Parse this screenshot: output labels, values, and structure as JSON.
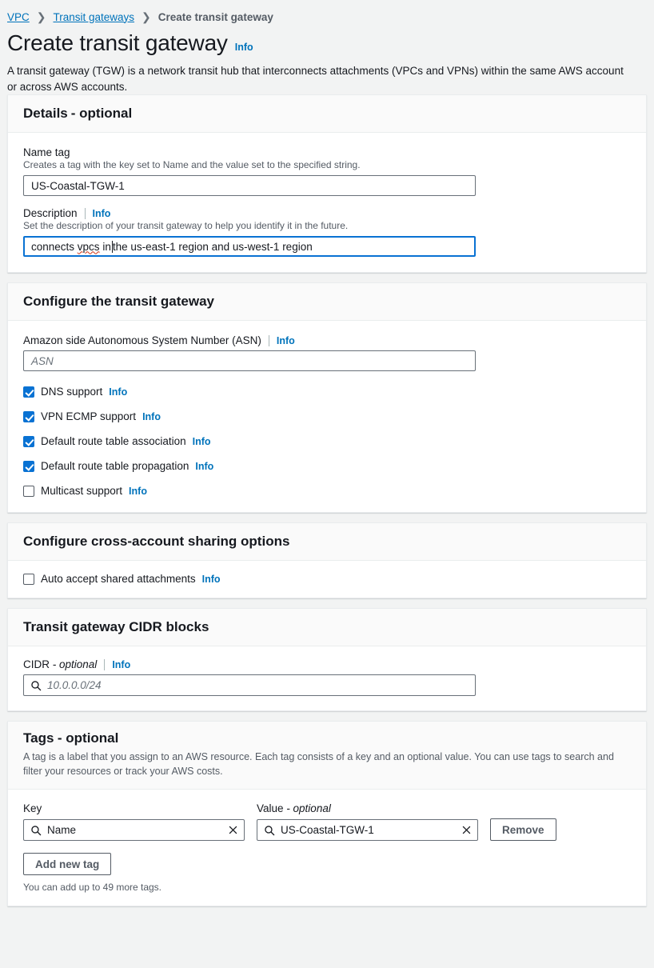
{
  "breadcrumb": {
    "items": [
      {
        "label": "VPC",
        "link": true
      },
      {
        "label": "Transit gateways",
        "link": true
      },
      {
        "label": "Create transit gateway",
        "link": false
      }
    ],
    "separator": "❯"
  },
  "header": {
    "title": "Create transit gateway",
    "info_label": "Info",
    "description": "A transit gateway (TGW) is a network transit hub that interconnects attachments (VPCs and VPNs) within the same AWS account or across AWS accounts."
  },
  "colors": {
    "link": "#0073bb",
    "info": "#0073bb",
    "accent": "#0972d3",
    "page_bg": "#f2f3f3",
    "panel_header_bg": "#fafafa",
    "panel_bg": "#ffffff",
    "border": "#687078",
    "muted_text": "#545b64",
    "spellcheck": "#d13212"
  },
  "details_panel": {
    "title": "Details",
    "title_optional": "- optional",
    "name_tag": {
      "label": "Name tag",
      "hint": "Creates a tag with the key set to Name and the value set to the specified string.",
      "value": "US-Coastal-TGW-1",
      "placeholder": ""
    },
    "description_field": {
      "label": "Description",
      "info_label": "Info",
      "hint": "Set the description of your transit gateway to help you identify it in the future.",
      "value_before_caret": "connects vpcs in",
      "value_after_caret": " the us-east-1 region and us-west-1 region",
      "misspelled_word": "vpcs",
      "focused": true
    }
  },
  "configure_panel": {
    "title": "Configure the transit gateway",
    "asn": {
      "label": "Amazon side Autonomous System Number (ASN)",
      "info_label": "Info",
      "value": "",
      "placeholder": "ASN"
    },
    "checkboxes": [
      {
        "label": "DNS support",
        "info_label": "Info",
        "checked": true
      },
      {
        "label": "VPN ECMP support",
        "info_label": "Info",
        "checked": true
      },
      {
        "label": "Default route table association",
        "info_label": "Info",
        "checked": true
      },
      {
        "label": "Default route table propagation",
        "info_label": "Info",
        "checked": true
      },
      {
        "label": "Multicast support",
        "info_label": "Info",
        "checked": false
      }
    ]
  },
  "sharing_panel": {
    "title": "Configure cross-account sharing options",
    "checkbox": {
      "label": "Auto accept shared attachments",
      "info_label": "Info",
      "checked": false
    }
  },
  "cidr_panel": {
    "title": "Transit gateway CIDR blocks",
    "cidr": {
      "label": "CIDR",
      "label_optional": "- optional",
      "info_label": "Info",
      "value": "",
      "placeholder": "10.0.0.0/24",
      "icon": "search-icon"
    }
  },
  "tags_panel": {
    "title": "Tags",
    "title_optional": "- optional",
    "description": "A tag is a label that you assign to an AWS resource. Each tag consists of a key and an optional value. You can use tags to search and filter your resources or track your AWS costs.",
    "columns": {
      "key": "Key",
      "value": "Value",
      "value_optional": "- optional"
    },
    "rows": [
      {
        "key": "Name",
        "value": "US-Coastal-TGW-1",
        "key_icon": "search-icon",
        "value_icon": "search-icon",
        "clear_icon": "close-icon",
        "remove_label": "Remove"
      }
    ],
    "add_button": "Add new tag",
    "note": "You can add up to 49 more tags."
  }
}
